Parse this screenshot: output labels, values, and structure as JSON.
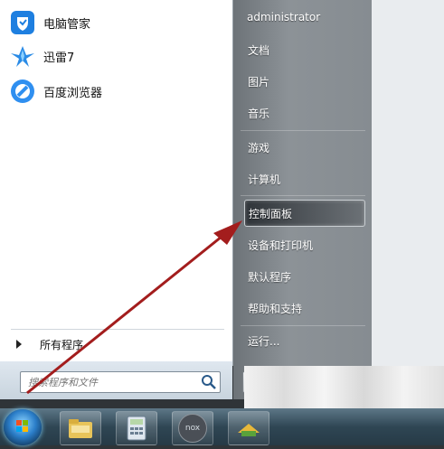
{
  "programs": [
    {
      "label": "电脑管家",
      "icon": "pc-manager-icon"
    },
    {
      "label": "迅雷7",
      "icon": "xunlei-icon"
    },
    {
      "label": "百度浏览器",
      "icon": "baidu-browser-icon"
    }
  ],
  "all_programs_label": "所有程序",
  "search": {
    "placeholder": "搜索程序和文件"
  },
  "right_menu": {
    "user": "administrator",
    "items": [
      "文档",
      "图片",
      "音乐",
      "游戏",
      "计算机",
      "控制面板",
      "设备和打印机",
      "默认程序",
      "帮助和支持",
      "运行..."
    ],
    "highlighted": "控制面板"
  },
  "taskbar": {
    "buttons": [
      {
        "icon": "file-explorer-icon"
      },
      {
        "icon": "calculator-icon"
      },
      {
        "icon": "nox-icon",
        "label": "nox"
      },
      {
        "icon": "app-icon"
      }
    ]
  },
  "colors": {
    "annotation_arrow": "#a31d1d",
    "menu_right": "#868c91",
    "taskbar": "#2f4654"
  }
}
